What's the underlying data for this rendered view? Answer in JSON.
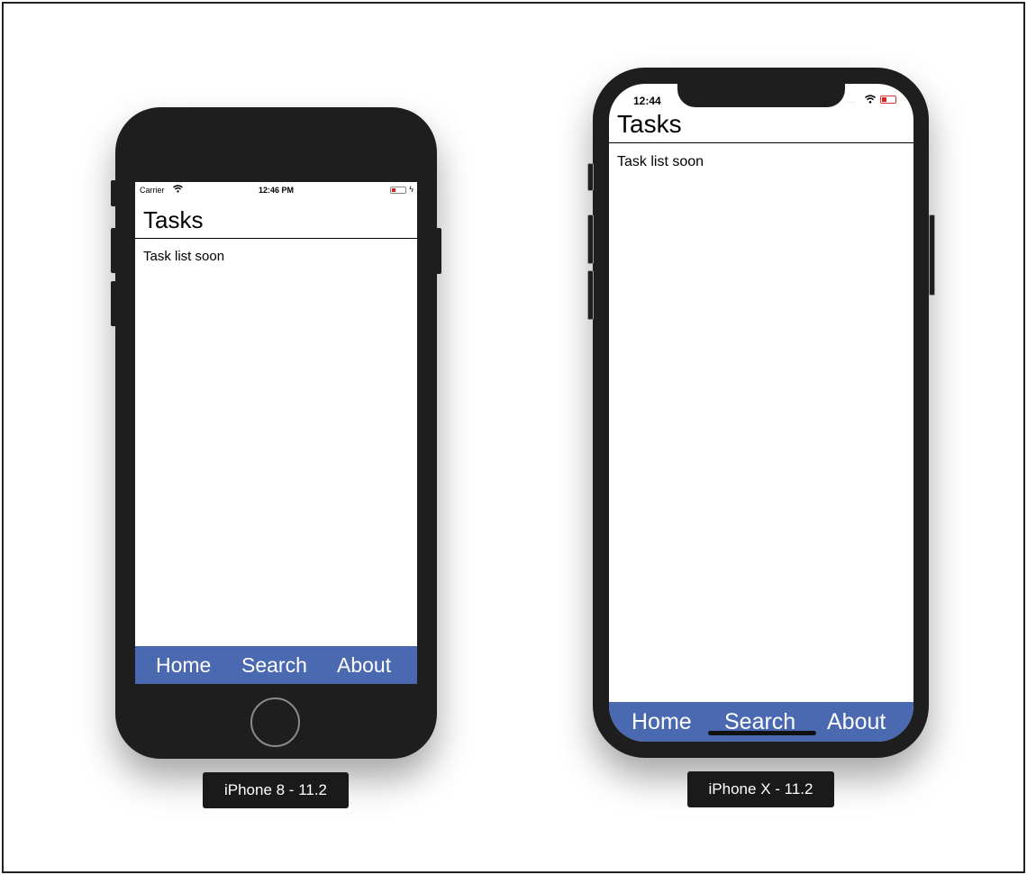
{
  "iphone8": {
    "status": {
      "carrier": "Carrier",
      "time": "12:46 PM",
      "battery_color": "#e0201c"
    },
    "title": "Tasks",
    "content": "Task list soon",
    "nav": {
      "items": [
        "Home",
        "Search",
        "About"
      ],
      "background": "#4a69b0"
    },
    "device_label": "iPhone 8 - 11.2"
  },
  "iphonex": {
    "status": {
      "time": "12:44",
      "signal": "....",
      "battery_color": "#e0201c"
    },
    "title": "Tasks",
    "content": "Task list soon",
    "nav": {
      "items": [
        "Home",
        "Search",
        "About"
      ],
      "background": "#4a69b0"
    },
    "device_label": "iPhone X - 11.2"
  }
}
